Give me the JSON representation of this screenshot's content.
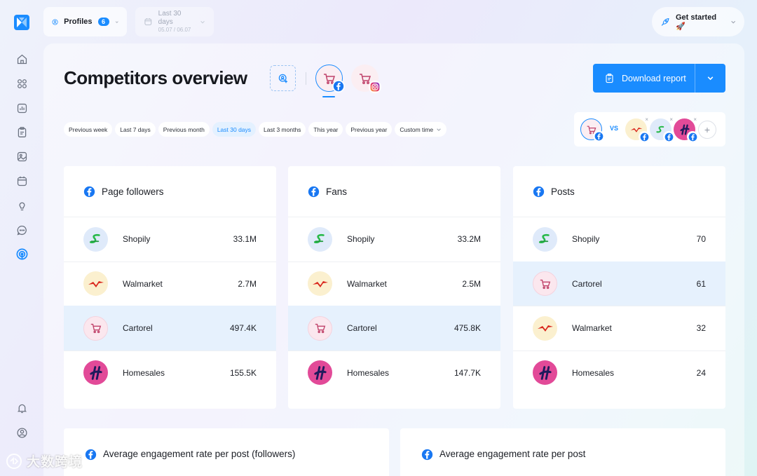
{
  "topbar": {
    "profiles_label": "Profiles",
    "profiles_count": "6",
    "date_label": "Last 30 days",
    "date_sub": "05.07 / 06.07",
    "get_started_label": "Get started 🚀"
  },
  "page": {
    "title": "Competitors overview",
    "download_label": "Download report"
  },
  "filters": [
    {
      "label": "Previous week",
      "active": false
    },
    {
      "label": "Last 7 days",
      "active": false
    },
    {
      "label": "Previous month",
      "active": false
    },
    {
      "label": "Last 30 days",
      "active": true
    },
    {
      "label": "Last 3 months",
      "active": false
    },
    {
      "label": "This year",
      "active": false
    },
    {
      "label": "Previous year",
      "active": false
    },
    {
      "label": "Custom time",
      "active": false
    }
  ],
  "compare": {
    "vs_label": "VS"
  },
  "cards": [
    {
      "title": "Page followers",
      "rows": [
        {
          "brand": "shopily",
          "name": "Shopily",
          "value": "33.1M",
          "highlight": false
        },
        {
          "brand": "walmarket",
          "name": "Walmarket",
          "value": "2.7M",
          "highlight": false
        },
        {
          "brand": "cartorel",
          "name": "Cartorel",
          "value": "497.4K",
          "highlight": true
        },
        {
          "brand": "homesales",
          "name": "Homesales",
          "value": "155.5K",
          "highlight": false
        }
      ]
    },
    {
      "title": "Fans",
      "rows": [
        {
          "brand": "shopily",
          "name": "Shopily",
          "value": "33.2M",
          "highlight": false
        },
        {
          "brand": "walmarket",
          "name": "Walmarket",
          "value": "2.5M",
          "highlight": false
        },
        {
          "brand": "cartorel",
          "name": "Cartorel",
          "value": "475.8K",
          "highlight": true
        },
        {
          "brand": "homesales",
          "name": "Homesales",
          "value": "147.7K",
          "highlight": false
        }
      ]
    },
    {
      "title": "Posts",
      "rows": [
        {
          "brand": "shopily",
          "name": "Shopily",
          "value": "70",
          "highlight": false
        },
        {
          "brand": "cartorel",
          "name": "Cartorel",
          "value": "61",
          "highlight": true
        },
        {
          "brand": "walmarket",
          "name": "Walmarket",
          "value": "32",
          "highlight": false
        },
        {
          "brand": "homesales",
          "name": "Homesales",
          "value": "24",
          "highlight": false
        }
      ]
    }
  ],
  "bottom_cards": [
    {
      "title": "Average engagement rate per post (followers)"
    },
    {
      "title": "Average engagement rate per post"
    }
  ],
  "watermark": "大数跨境",
  "colors": {
    "accent": "#1a8cff",
    "facebook": "#1877f2",
    "highlight_row": "#e6f1fd"
  }
}
